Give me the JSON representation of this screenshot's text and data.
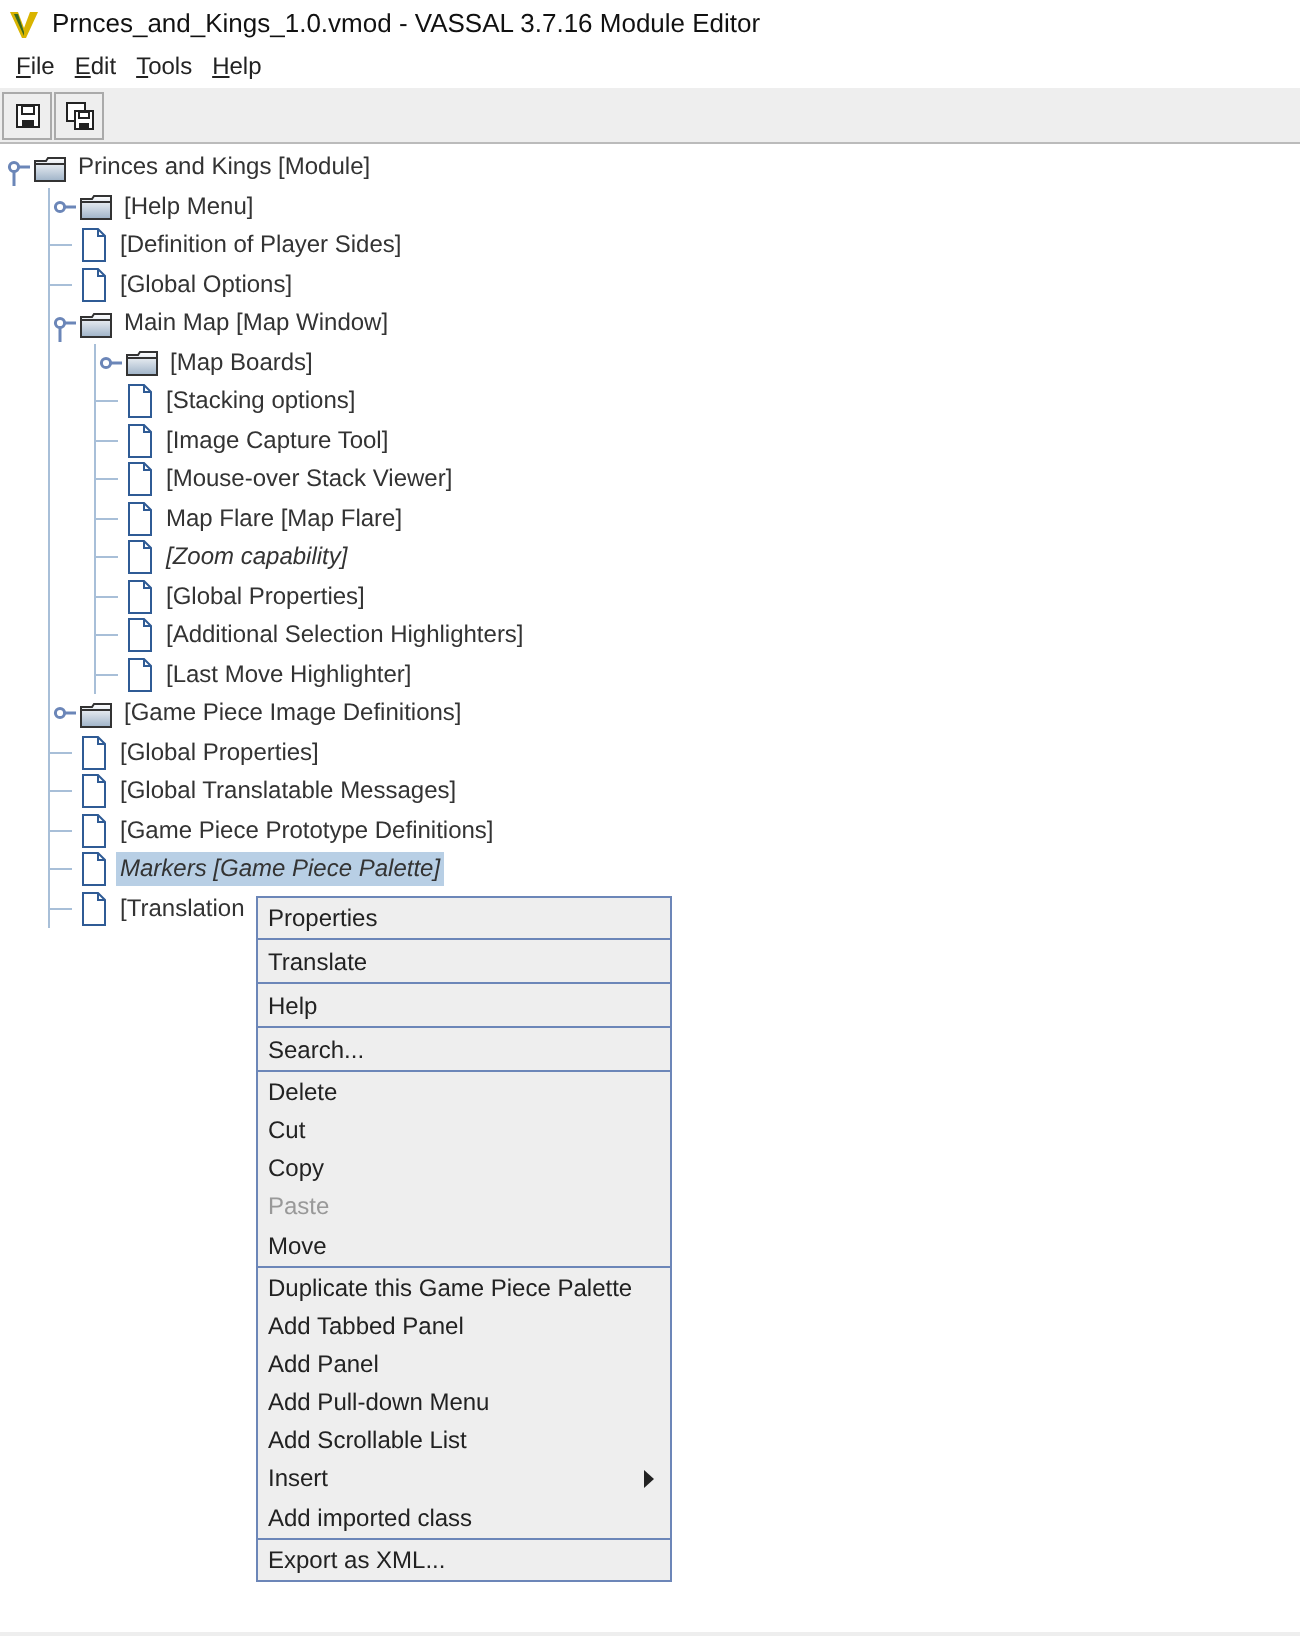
{
  "window": {
    "title": "Prnces_and_Kings_1.0.vmod - VASSAL 3.7.16 Module Editor"
  },
  "menu_bar": [
    "File",
    "Edit",
    "Tools",
    "Help"
  ],
  "toolbar": [
    {
      "kind": "save"
    },
    {
      "kind": "save-as"
    }
  ],
  "tree": [
    {
      "label": "Princes and Kings [Module]",
      "kind": "folder",
      "expanded": true,
      "italic": false,
      "selected": false,
      "children": [
        {
          "label": "[Help Menu]",
          "kind": "folder",
          "expanded": false,
          "italic": false,
          "selected": false
        },
        {
          "label": "[Definition of Player Sides]",
          "kind": "file",
          "italic": false,
          "selected": false
        },
        {
          "label": "[Global Options]",
          "kind": "file",
          "italic": false,
          "selected": false
        },
        {
          "label": "Main Map [Map Window]",
          "kind": "folder",
          "expanded": true,
          "italic": false,
          "selected": false,
          "children": [
            {
              "label": "[Map Boards]",
              "kind": "folder",
              "expanded": false,
              "italic": false,
              "selected": false
            },
            {
              "label": "[Stacking options]",
              "kind": "file",
              "italic": false,
              "selected": false
            },
            {
              "label": "[Image Capture Tool]",
              "kind": "file",
              "italic": false,
              "selected": false
            },
            {
              "label": "[Mouse-over Stack Viewer]",
              "kind": "file",
              "italic": false,
              "selected": false
            },
            {
              "label": "Map Flare [Map Flare]",
              "kind": "file",
              "italic": false,
              "selected": false
            },
            {
              "label": "[Zoom capability]",
              "kind": "file",
              "italic": true,
              "selected": false
            },
            {
              "label": "[Global Properties]",
              "kind": "file",
              "italic": false,
              "selected": false
            },
            {
              "label": "[Additional Selection Highlighters]",
              "kind": "file",
              "italic": false,
              "selected": false
            },
            {
              "label": "[Last Move Highlighter]",
              "kind": "file",
              "italic": false,
              "selected": false
            }
          ]
        },
        {
          "label": "[Game Piece Image Definitions]",
          "kind": "folder",
          "expanded": false,
          "italic": false,
          "selected": false
        },
        {
          "label": "[Global Properties]",
          "kind": "file",
          "italic": false,
          "selected": false
        },
        {
          "label": "[Global Translatable Messages]",
          "kind": "file",
          "italic": false,
          "selected": false
        },
        {
          "label": "[Game Piece Prototype Definitions]",
          "kind": "file",
          "italic": false,
          "selected": false
        },
        {
          "label": "Markers [Game Piece Palette]",
          "kind": "file",
          "italic": true,
          "selected": true
        },
        {
          "label": "[Translation",
          "kind": "file",
          "italic": false,
          "selected": false
        }
      ]
    }
  ],
  "context_menu": [
    {
      "label": "Properties",
      "disabled": false,
      "submenu": false,
      "separator_after": true
    },
    {
      "label": "Translate",
      "disabled": false,
      "submenu": false,
      "separator_after": true
    },
    {
      "label": "Help",
      "disabled": false,
      "submenu": false,
      "separator_after": true
    },
    {
      "label": "Search...",
      "disabled": false,
      "submenu": false,
      "separator_after": true
    },
    {
      "label": "Delete",
      "disabled": false,
      "submenu": false,
      "separator_after": false
    },
    {
      "label": "Cut",
      "disabled": false,
      "submenu": false,
      "separator_after": false
    },
    {
      "label": "Copy",
      "disabled": false,
      "submenu": false,
      "separator_after": false
    },
    {
      "label": "Paste",
      "disabled": true,
      "submenu": false,
      "separator_after": false
    },
    {
      "label": "Move",
      "disabled": false,
      "submenu": false,
      "separator_after": true
    },
    {
      "label": "Duplicate this Game Piece Palette",
      "disabled": false,
      "submenu": false,
      "separator_after": false
    },
    {
      "label": "Add Tabbed Panel",
      "disabled": false,
      "submenu": false,
      "separator_after": false
    },
    {
      "label": "Add Panel",
      "disabled": false,
      "submenu": false,
      "separator_after": false
    },
    {
      "label": "Add Pull-down Menu",
      "disabled": false,
      "submenu": false,
      "separator_after": false
    },
    {
      "label": "Add Scrollable List",
      "disabled": false,
      "submenu": false,
      "separator_after": false
    },
    {
      "label": "Insert",
      "disabled": false,
      "submenu": true,
      "separator_after": false
    },
    {
      "label": "Add imported class",
      "disabled": false,
      "submenu": false,
      "separator_after": true
    },
    {
      "label": "Export as XML...",
      "disabled": false,
      "submenu": false,
      "separator_after": false
    }
  ]
}
